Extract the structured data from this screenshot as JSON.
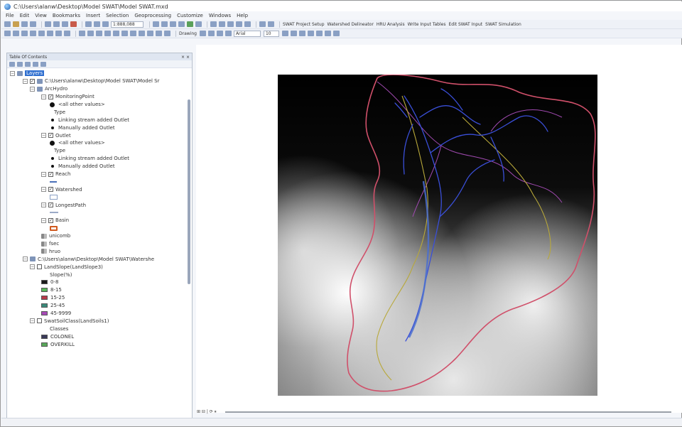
{
  "window": {
    "title": "C:\\Users\\alanw\\Desktop\\Model SWAT\\Model SWAT.mxd"
  },
  "menu": [
    "File",
    "Edit",
    "View",
    "Bookmarks",
    "Insert",
    "Selection",
    "Geoprocessing",
    "Customize",
    "Windows",
    "Help"
  ],
  "toolbar": {
    "scale": "1:888,088",
    "drawing_label": "Drawing",
    "font_name": "Arial",
    "font_size": "10",
    "swat_project_setup": "SWAT Project Setup",
    "watershed_delineator": "Watershed Delineator",
    "hru_analysis": "HRU Analysis",
    "write_input_tables": "Write Input Tables",
    "edit_swat_input": "Edit SWAT Input",
    "swat_simulation": "SWAT Simulation"
  },
  "toc": {
    "header": "Table Of Contents",
    "rows": [
      {
        "indent": 0,
        "exp": "−",
        "icon": "layers",
        "text": "Layers",
        "selected": true
      },
      {
        "indent": 1,
        "exp": "−",
        "chk": "✓",
        "icon": "group",
        "text": "C:\\Users\\alanw\\Desktop\\Model SWAT\\Model Sr"
      },
      {
        "indent": 2,
        "exp": "−",
        "icon": "group",
        "text": "ArcHydro"
      },
      {
        "indent": 3,
        "exp": "−",
        "chk": "✓",
        "text": "MonitoringPoint"
      },
      {
        "indent": 4,
        "sym": "dot-lg",
        "text": "<all other values>"
      },
      {
        "indent": 5,
        "text": "Type"
      },
      {
        "indent": 4,
        "sym": "dot-sm",
        "text": "Linking stream added Outlet"
      },
      {
        "indent": 4,
        "sym": "dot-sm",
        "text": "Manually added Outlet"
      },
      {
        "indent": 3,
        "exp": "−",
        "chk": "✓",
        "text": "Outlet"
      },
      {
        "indent": 4,
        "sym": "dot-lg",
        "text": "<all other values>"
      },
      {
        "indent": 5,
        "text": "Type"
      },
      {
        "indent": 4,
        "sym": "dot-sm",
        "text": "Linking stream added Outlet"
      },
      {
        "indent": 4,
        "sym": "dot-sm",
        "text": "Manually added Outlet"
      },
      {
        "indent": 3,
        "exp": "−",
        "chk": "✓",
        "text": "Reach"
      },
      {
        "indent": 4,
        "sym": "line",
        "text": ""
      },
      {
        "indent": 3,
        "exp": "−",
        "chk": "✓",
        "text": "Watershed"
      },
      {
        "indent": 4,
        "sym": "poly",
        "text": ""
      },
      {
        "indent": 3,
        "exp": "−",
        "chk": "✓",
        "text": "LongestPath"
      },
      {
        "indent": 4,
        "sym": "path",
        "text": ""
      },
      {
        "indent": 3,
        "exp": "−",
        "chk": "✓",
        "text": "Basin"
      },
      {
        "indent": 4,
        "sym": "poly-red",
        "text": ""
      },
      {
        "indent": 3,
        "icon": "grid",
        "text": "unicomb"
      },
      {
        "indent": 3,
        "icon": "grid",
        "text": "fsec"
      },
      {
        "indent": 3,
        "icon": "grid",
        "text": "hruo"
      },
      {
        "indent": 1,
        "exp": "−",
        "icon": "group",
        "text": "C:\\Users\\alanw\\Desktop\\Model SWAT\\Watershe"
      },
      {
        "indent": 2,
        "exp": "−",
        "chk": "",
        "text": "LandSlope(LandSlope3)"
      },
      {
        "indent": 4,
        "text": "Slope(%)"
      },
      {
        "indent": 3,
        "sym": "swatch",
        "color": "#1a1a1a",
        "text": "0-8"
      },
      {
        "indent": 3,
        "sym": "swatch",
        "color": "#58b85a",
        "text": "8-15"
      },
      {
        "indent": 3,
        "sym": "swatch",
        "color": "#b83a4a",
        "text": "15-25"
      },
      {
        "indent": 3,
        "sym": "swatch",
        "color": "#3a8a7a",
        "text": "25-45"
      },
      {
        "indent": 3,
        "sym": "swatch",
        "color": "#a84ab8",
        "text": "45-9999"
      },
      {
        "indent": 2,
        "exp": "−",
        "chk": "",
        "text": "SwatSoilClass(LandSoils1)"
      },
      {
        "indent": 4,
        "text": "Classes"
      },
      {
        "indent": 3,
        "sym": "swatch",
        "color": "#3a3a5a",
        "text": "COLONEL"
      },
      {
        "indent": 3,
        "sym": "swatch",
        "color": "#58a85a",
        "text": "OVERKILL"
      }
    ]
  },
  "statusbar": {
    "page_controls": "⊞ ⊟ | ⟳ ⏸"
  },
  "colors": {
    "accent": "#2f6fd0",
    "reach": "#3a4fd8",
    "basin": "#d0506a",
    "longest_path": "#b8a83a",
    "subbasin": "#a04ab0"
  }
}
